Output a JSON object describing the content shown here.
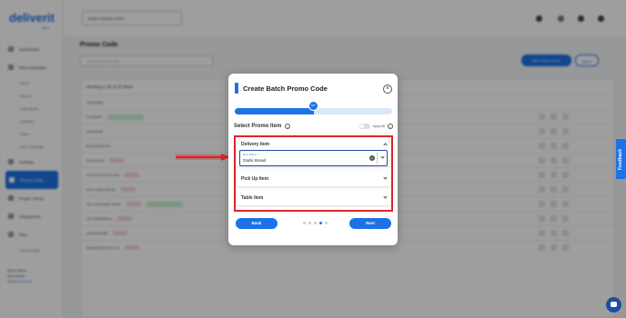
{
  "app": {
    "logo": "deliverit",
    "logo_sub": "DEV"
  },
  "topbar": {
    "store_select": "Dusk Industry Store"
  },
  "sidebar": {
    "items": [
      {
        "label": "Dashboard"
      },
      {
        "label": "Menu Manager"
      }
    ],
    "sub_items": [
      "Items",
      "Menus",
      "Ingredients",
      "Modifiers",
      "Sizes",
      "Menu Settings"
    ],
    "items2": [
      {
        "label": "Settings"
      },
      {
        "label": "Promo Code"
      },
      {
        "label": "Image Library"
      },
      {
        "label": "Integrations"
      },
      {
        "label": "Misc"
      }
    ],
    "sub_items2": [
      "Testimonials"
    ],
    "footer": [
      "Store Name",
      "Dev Admin",
      "Switch Account"
    ]
  },
  "main": {
    "title": "Promo Code",
    "search_placeholder": "Search Promo Code",
    "add_button": "Add Promo Code",
    "ghost_button": "Import",
    "showing": "Showing 1-20 of 32 items",
    "rows": [
      "Campaign",
      "Food2HP",
      "Schlemvik",
      "Buy1Get1Free",
      "Pizza Deal",
      "10 Percent Discount",
      "Free Garlic Bread",
      "Our Campaign Name",
      "UK Club2MeDe",
      "pricedemo88",
      "Marketing Promo 20"
    ]
  },
  "modal": {
    "title": "Create Batch Promo Code",
    "progress": 0.5,
    "progress_step_label": "4/5",
    "section_title": "Select Promo Item",
    "apply_all_label": "Apply All",
    "delivery": {
      "title": "Delivery Item",
      "field_label": "Item Name *",
      "field_value": "Garlic Bread"
    },
    "pickup": {
      "title": "Pick Up Item"
    },
    "table": {
      "title": "Table Item"
    },
    "back_label": "Back",
    "next_label": "Next",
    "steps_total": 5,
    "step_active": 4
  },
  "feedback_label": "Feedback",
  "colors": {
    "accent": "#1d72e8",
    "highlight": "#e0232b"
  }
}
